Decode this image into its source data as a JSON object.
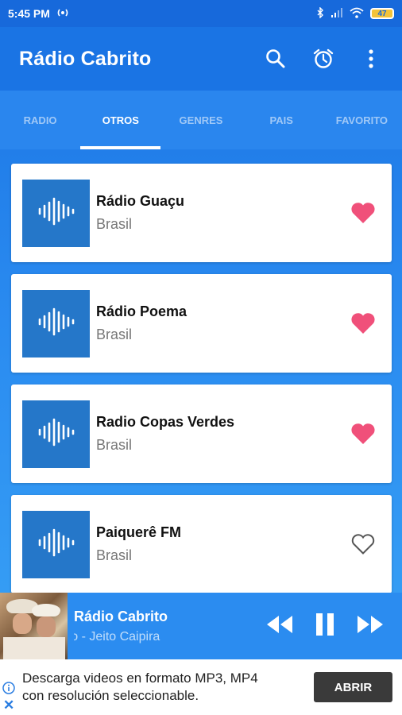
{
  "status": {
    "time": "5:45 PM",
    "battery": "47"
  },
  "app": {
    "title": "Rádio Cabrito"
  },
  "tabs": [
    "RADIO",
    "OTROS",
    "GENRES",
    "PAIS",
    "FAVORITO"
  ],
  "stations": [
    {
      "name": "Rádio Guaçu",
      "country": "Brasil",
      "favorite": true
    },
    {
      "name": "Rádio Poema",
      "country": "Brasil",
      "favorite": true
    },
    {
      "name": "Radio Copas Verdes",
      "country": "Brasil",
      "favorite": true
    },
    {
      "name": "Paiquerê FM",
      "country": "Brasil",
      "favorite": false
    }
  ],
  "player": {
    "title": "Rádio Cabrito",
    "subtitle": "Geno - Jeito Caipira"
  },
  "ad": {
    "text_line1": "Descarga videos en formato MP3, MP4",
    "text_line2": "con resolución seleccionable.",
    "button": "ABRIR"
  },
  "colors": {
    "accent": "#1a74e4",
    "heart": "#f0507a",
    "thumb": "#2577c9"
  }
}
